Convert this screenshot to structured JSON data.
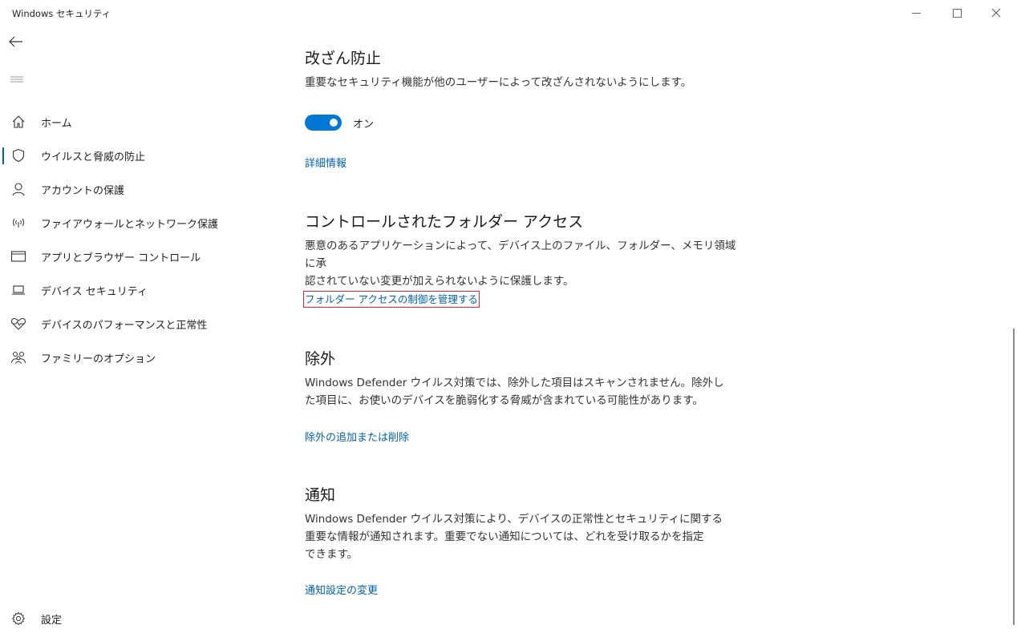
{
  "window": {
    "title": "Windows セキュリティ"
  },
  "nav": {
    "items": [
      {
        "label": "ホーム",
        "icon": "home-icon"
      },
      {
        "label": "ウイルスと脅威の防止",
        "icon": "shield-icon",
        "selected": true
      },
      {
        "label": "アカウントの保護",
        "icon": "person-icon"
      },
      {
        "label": "ファイアウォールとネットワーク保護",
        "icon": "wireless-icon"
      },
      {
        "label": "アプリとブラウザー コントロール",
        "icon": "app-window-icon"
      },
      {
        "label": "デバイス セキュリティ",
        "icon": "laptop-icon"
      },
      {
        "label": "デバイスのパフォーマンスと正常性",
        "icon": "heart-pulse-icon"
      },
      {
        "label": "ファミリーのオプション",
        "icon": "family-icon"
      }
    ],
    "settings_label": "設定"
  },
  "sections": {
    "tamper": {
      "title": "改ざん防止",
      "description": "重要なセキュリティ機能が他のユーザーによって改ざんされないようにします。",
      "toggle_state": "オン",
      "link": "詳細情報"
    },
    "cfa": {
      "title": "コントロールされたフォルダー アクセス",
      "description_line1": "悪意のあるアプリケーションによって、デバイス上のファイル、フォルダー、メモリ領域に承",
      "description_line2": "認されていない変更が加えられないように保護します。",
      "link": "フォルダー アクセスの制御を管理する"
    },
    "exclusions": {
      "title": "除外",
      "description_line1": "Windows Defender ウイルス対策では、除外した項目はスキャンされません。除外し",
      "description_line2": "た項目に、お使いのデバイスを脆弱化する脅威が含まれている可能性があります。",
      "link": "除外の追加または削除"
    },
    "notifications": {
      "title": "通知",
      "description_line1": "Windows Defender ウイルス対策により、デバイスの正常性とセキュリティに関する",
      "description_line2": "重要な情報が通知されます。重要でない通知については、どれを受け取るかを指定",
      "description_line3": "できます。",
      "link": "通知設定の変更"
    }
  },
  "colors": {
    "accent": "#0078d7",
    "link": "#0063b1",
    "highlight_box": "#e0262b"
  }
}
